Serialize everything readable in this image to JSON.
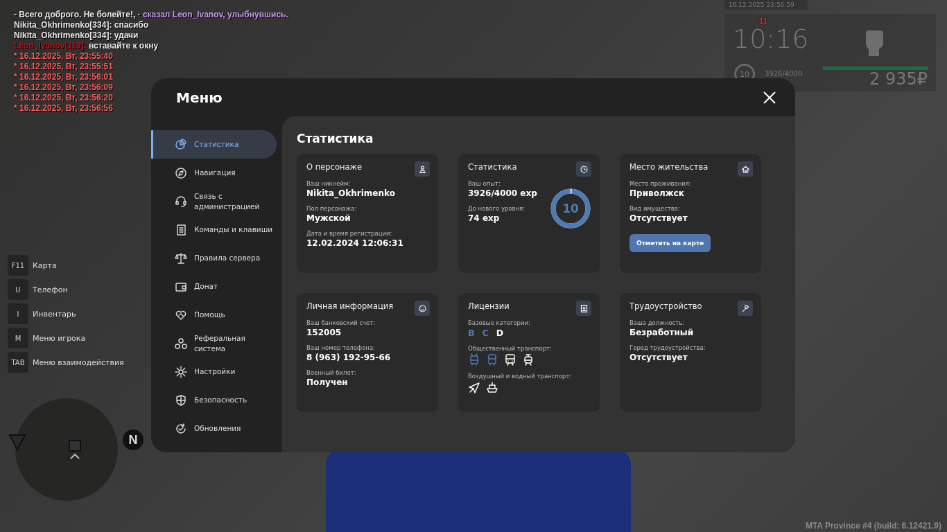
{
  "chat": [
    {
      "segments": [
        {
          "text": "- Всего доброго. Не болейте!,",
          "color": "#e8e8e8"
        },
        {
          "text": " - сказал Leon_Ivanov, улыбнувшись.",
          "color": "#c99af2"
        }
      ]
    },
    {
      "segments": [
        {
          "text": "Nikita_Okhrimenko[334]: спасибо",
          "color": "#e8e8e8"
        }
      ]
    },
    {
      "segments": [
        {
          "text": "Nikita_Okhrimenko[334]: удачи",
          "color": "#e8e8e8"
        }
      ]
    },
    {
      "segments": [
        {
          "text": "Leon_Ivanov[119]:",
          "color": "#b51414"
        },
        {
          "text": " вставайте к окну",
          "color": "#e8e8e8"
        }
      ]
    },
    {
      "segments": [
        {
          "text": "* 16.12.2025, Вт, 23:55:40",
          "color": "#ff5a5a"
        }
      ]
    },
    {
      "segments": [
        {
          "text": "* 16.12.2025, Вт, 23:55:51",
          "color": "#ff5a5a"
        }
      ]
    },
    {
      "segments": [
        {
          "text": "* 16.12.2025, Вт, 23:56:01",
          "color": "#ff5a5a"
        }
      ]
    },
    {
      "segments": [
        {
          "text": "* 16.12.2025, Вт, 23:56:09",
          "color": "#ff5a5a"
        }
      ]
    },
    {
      "segments": [
        {
          "text": "* 16.12.2025, Вт, 23:56:20",
          "color": "#ff5a5a"
        }
      ]
    },
    {
      "segments": [
        {
          "text": "* 16.12.2025, Вт, 23:56:56",
          "color": "#ff5a5a"
        }
      ]
    }
  ],
  "hud": {
    "datetime": "16.12.2025 23:56:59",
    "wanted": "11",
    "clock": "10:16",
    "level": "10",
    "exp": "3926/4000",
    "health": {
      "level": 1
    },
    "money": "2 935₽"
  },
  "keybinds": [
    {
      "key": "F11",
      "label": "Карта"
    },
    {
      "key": "U",
      "label": "Телефон"
    },
    {
      "key": "I",
      "label": "Инвентарь"
    },
    {
      "key": "M",
      "label": "Меню игрока"
    },
    {
      "key": "TAB",
      "label": "Меню взаимодействия"
    }
  ],
  "minimap": {
    "north": "N"
  },
  "build": "MTA Province #4 (build: 6.12421.9)",
  "menu": {
    "title": "Меню",
    "sidebar": {
      "items": [
        {
          "label": "Статистика",
          "selected": true
        },
        {
          "label": "Навигация",
          "selected": false
        },
        {
          "label": "Связь с администрацией",
          "selected": false
        },
        {
          "label": "Команды и клавиши",
          "selected": false
        },
        {
          "label": "Правила сервера",
          "selected": false
        },
        {
          "label": "Донат",
          "selected": false
        },
        {
          "label": "Помощь",
          "selected": false
        },
        {
          "label": "Реферальная система",
          "selected": false
        },
        {
          "label": "Настройки",
          "selected": false
        },
        {
          "label": "Безопасность",
          "selected": false
        },
        {
          "label": "Обновления",
          "selected": false
        }
      ]
    },
    "content": {
      "title": "Статистика",
      "cards": [
        {
          "title": "О персонаже",
          "fields": [
            {
              "kind": "text",
              "label": "Ваш никнейм:",
              "value": "Nikita_Okhrimenko"
            },
            {
              "kind": "text",
              "label": "Пол персонажа:",
              "value": "Мужской"
            },
            {
              "kind": "text",
              "label": "Дата и время регистрации:",
              "value": "12.02.2024 12:06:31"
            }
          ]
        },
        {
          "title": "Статистика",
          "fields": [
            {
              "kind": "text",
              "label": "Ваш опыт:",
              "value": "3926/4000 exp"
            },
            {
              "kind": "text",
              "label": "До нового уровня:",
              "value": "74 exp"
            }
          ],
          "ring": {
            "text": "10",
            "level": 0.98
          }
        },
        {
          "title": "Место жительства",
          "fields": [
            {
              "kind": "text",
              "label": "Место проживания:",
              "value": "Приволжск"
            },
            {
              "kind": "text",
              "label": "Вид имущества:",
              "value": "Отсутствует"
            }
          ],
          "button": "Отметить на карте"
        },
        {
          "title": "Личная информация",
          "fields": [
            {
              "kind": "text",
              "label": "Ваш банковский счет:",
              "value": "152005"
            },
            {
              "kind": "text",
              "label": "Ваш номер телефона:",
              "value": "8 (963) 192-95-66"
            },
            {
              "kind": "text",
              "label": "Военный билет:",
              "value": "Получен"
            }
          ]
        },
        {
          "title": "Лицензии",
          "fields": [
            {
              "kind": "categories",
              "label": "Базовые категории:",
              "items": [
                {
                  "text": "B",
                  "active": true
                },
                {
                  "text": "C",
                  "active": true
                },
                {
                  "text": "D",
                  "active": false
                }
              ]
            },
            {
              "kind": "icons",
              "label": "Общественный транспорт:",
              "items": [
                {
                  "kind": "trolleybus",
                  "active": true
                },
                {
                  "kind": "bus",
                  "active": true
                },
                {
                  "kind": "train",
                  "active": false
                },
                {
                  "kind": "tram",
                  "active": false
                }
              ]
            },
            {
              "kind": "icons",
              "label": "Воздушный и водный транспорт:",
              "items": [
                {
                  "kind": "airplane",
                  "active": false
                },
                {
                  "kind": "boat",
                  "active": false
                }
              ]
            }
          ]
        },
        {
          "title": "Трудоустройство",
          "fields": [
            {
              "kind": "text",
              "label": "Ваша должность:",
              "value": "Безработный"
            },
            {
              "kind": "text",
              "label": "Город трудоустройства:",
              "value": "Отсутствует"
            }
          ]
        }
      ]
    }
  }
}
